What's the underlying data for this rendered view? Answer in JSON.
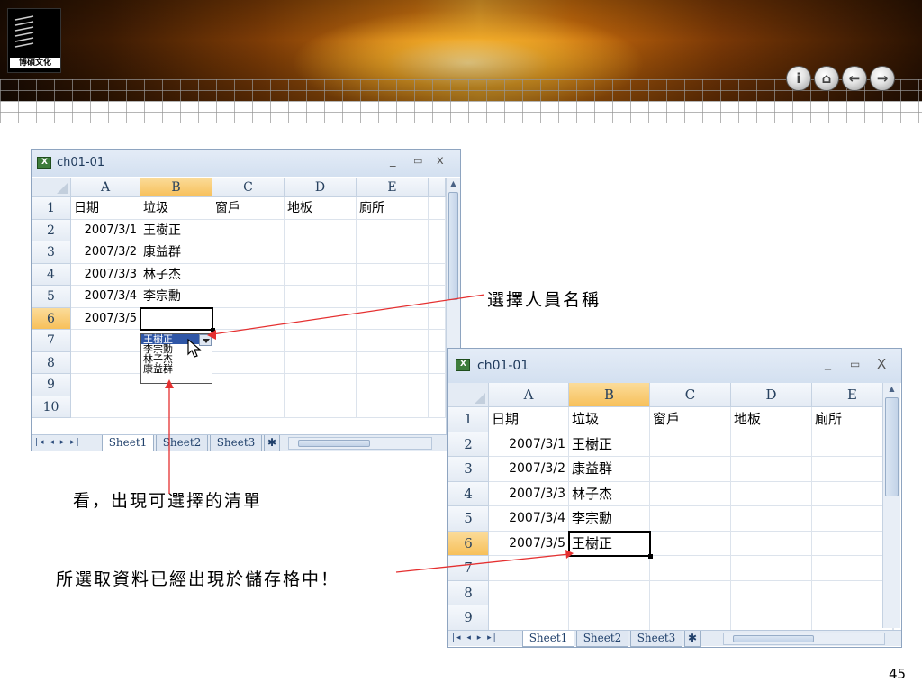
{
  "header": {
    "logo_text": "博碩文化",
    "nav_icons": [
      "info-icon",
      "home-icon",
      "back-icon",
      "forward-icon"
    ]
  },
  "window1": {
    "title": "ch01-01",
    "controls": [
      "_",
      "▭",
      "x"
    ],
    "columns": [
      "A",
      "B",
      "C",
      "D",
      "E"
    ],
    "row_numbers": [
      "1",
      "2",
      "3",
      "4",
      "5",
      "6",
      "7",
      "8",
      "9",
      "10"
    ],
    "rows": [
      [
        "日期",
        "垃圾",
        "窗戶",
        "地板",
        "廁所"
      ],
      [
        "2007/3/1",
        "王樹正",
        "",
        "",
        ""
      ],
      [
        "2007/3/2",
        "康益群",
        "",
        "",
        ""
      ],
      [
        "2007/3/3",
        "林子杰",
        "",
        "",
        ""
      ],
      [
        "2007/3/4",
        "李宗勳",
        "",
        "",
        ""
      ],
      [
        "2007/3/5",
        "",
        "",
        "",
        ""
      ]
    ],
    "dropdown_items": [
      "王樹正",
      "李宗勳",
      "林子杰",
      "康益群"
    ],
    "sheet_tabs": [
      "Sheet1",
      "Sheet2",
      "Sheet3"
    ]
  },
  "window2": {
    "title": "ch01-01",
    "controls": [
      "_",
      "▭",
      "X"
    ],
    "columns": [
      "A",
      "B",
      "C",
      "D",
      "E"
    ],
    "row_numbers": [
      "1",
      "2",
      "3",
      "4",
      "5",
      "6",
      "7",
      "8",
      "9"
    ],
    "rows": [
      [
        "日期",
        "垃圾",
        "窗戶",
        "地板",
        "廁所"
      ],
      [
        "2007/3/1",
        "王樹正",
        "",
        "",
        ""
      ],
      [
        "2007/3/2",
        "康益群",
        "",
        "",
        ""
      ],
      [
        "2007/3/3",
        "林子杰",
        "",
        "",
        ""
      ],
      [
        "2007/3/4",
        "李宗勳",
        "",
        "",
        ""
      ],
      [
        "2007/3/5",
        "王樹正",
        "",
        "",
        ""
      ]
    ],
    "sheet_tabs": [
      "Sheet1",
      "Sheet2",
      "Sheet3"
    ]
  },
  "annotations": {
    "select_person": "選擇人員名稱",
    "see_list": "看，出現可選擇的清單",
    "result": "所選取資料已經出現於儲存格中！"
  },
  "page_number": "45",
  "colors": {
    "selection_highlight": "#2f56a6",
    "active_header": "#f7c05a",
    "annotation_line": "#e53030"
  }
}
